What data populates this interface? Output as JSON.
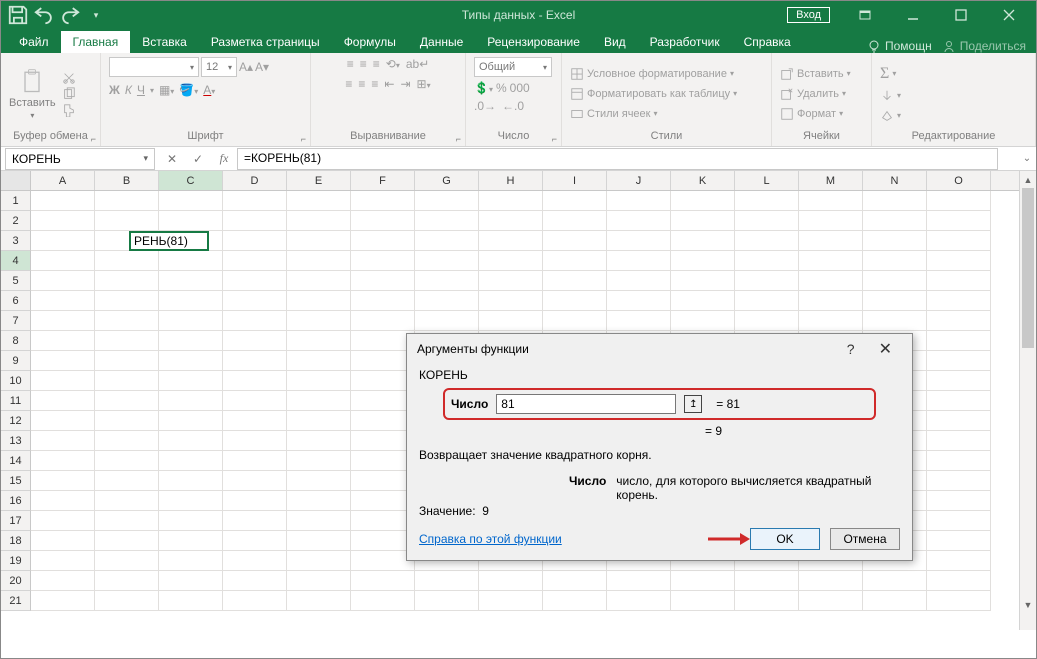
{
  "title": "Типы данных  -  Excel",
  "login": "Вход",
  "tabs": [
    "Файл",
    "Главная",
    "Вставка",
    "Разметка страницы",
    "Формулы",
    "Данные",
    "Рецензирование",
    "Вид",
    "Разработчик",
    "Справка"
  ],
  "active_tab": 1,
  "tell_me": "Помощн",
  "share": "Поделиться",
  "ribbon": {
    "clipboard": {
      "paste": "Вставить",
      "label": "Буфер обмена"
    },
    "font": {
      "name": "",
      "size": "12",
      "row2": [
        "Ж",
        "К",
        "Ч"
      ],
      "label": "Шрифт"
    },
    "align": {
      "label": "Выравнивание"
    },
    "number": {
      "format": "Общий",
      "label": "Число"
    },
    "styles": {
      "cond": "Условное форматирование",
      "table": "Форматировать как таблицу",
      "cell": "Стили ячеек",
      "label": "Стили"
    },
    "cells": {
      "insert": "Вставить",
      "delete": "Удалить",
      "format": "Формат",
      "label": "Ячейки"
    },
    "editing": {
      "label": "Редактирование"
    }
  },
  "namebox": "КОРЕНЬ",
  "formula": "=КОРЕНЬ(81)",
  "columns": [
    "A",
    "B",
    "C",
    "D",
    "E",
    "F",
    "G",
    "H",
    "I",
    "J",
    "K",
    "L",
    "M",
    "N",
    "O"
  ],
  "row_count": 21,
  "active_cell_display": "РЕНЬ(81)",
  "highlight_col": "C",
  "highlight_row": 4,
  "dialog": {
    "title": "Аргументы функции",
    "fname": "КОРЕНЬ",
    "arg_label": "Число",
    "arg_value": "81",
    "arg_eval": "=  81",
    "result_line": "=  9",
    "desc": "Возвращает значение квадратного корня.",
    "arg_name2": "Число",
    "arg_desc2": "число, для которого вычисляется квадратный корень.",
    "value_label": "Значение:",
    "value": "9",
    "help_link": "Справка по этой функции",
    "ok": "OK",
    "cancel": "Отмена"
  }
}
